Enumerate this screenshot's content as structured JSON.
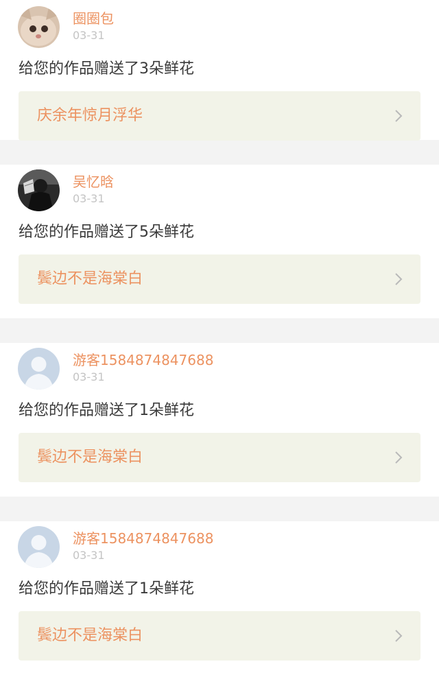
{
  "notifications": [
    {
      "avatar": "cat-photo-avatar",
      "user": "圈圈包",
      "date": "03-31",
      "message": "给您的作品赠送了3朵鲜花",
      "work": "庆余年惊月浮华"
    },
    {
      "avatar": "person-photo-avatar",
      "user": "吴忆晗",
      "date": "03-31",
      "message": "给您的作品赠送了5朵鲜花",
      "work": "鬓边不是海棠白"
    },
    {
      "avatar": "default-user-avatar",
      "user": "游客1584874847688",
      "date": "03-31",
      "message": "给您的作品赠送了1朵鲜花",
      "work": "鬓边不是海棠白"
    },
    {
      "avatar": "default-user-avatar",
      "user": "游客1584874847688",
      "date": "03-31",
      "message": "给您的作品赠送了1朵鲜花",
      "work": "鬓边不是海棠白"
    }
  ],
  "colors": {
    "name": "#ec9260",
    "tab_indicator": "#e684a8",
    "card_bg": "#f2f3e8",
    "separator": "#f3f3f3"
  },
  "icons": {
    "chevron": "chevron-right-icon"
  }
}
